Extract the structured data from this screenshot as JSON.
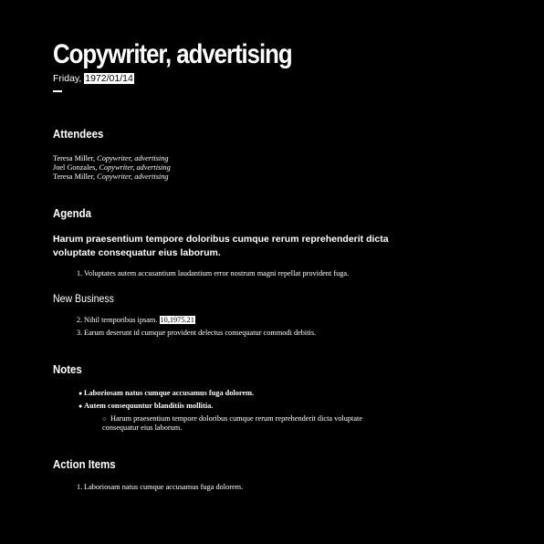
{
  "doc": {
    "title": "Copywriter, advertising",
    "day": "Friday,",
    "date": "1972/01/14"
  },
  "attendees": {
    "heading": "Attendees",
    "people": [
      {
        "name": "Teresa Miller,",
        "role": "Copywriter, advertising"
      },
      {
        "name": "Joel Gonzales,",
        "role": "Copywriter, advertising"
      },
      {
        "name": "Teresa Miller,",
        "role": "Copywriter, advertising"
      }
    ]
  },
  "agenda": {
    "heading": "Agenda",
    "lead": "Harum praesentium tempore doloribus cumque rerum reprehenderit dicta voluptate consequatur eius laborum.",
    "items": [
      {
        "num": "1.",
        "text": "Voluptates autem accusantium laudantium error nostrum magni repellat provident fuga."
      }
    ],
    "subheading": "New Business",
    "items2": [
      {
        "num": "2.",
        "text": "Nihil temporibus ipsam.",
        "tag": "10,1975.21"
      },
      {
        "num": "3.",
        "text": "Earum deserunt id cumque provident delectus consequatur commodi debitis."
      }
    ]
  },
  "notes": {
    "heading": "Notes",
    "items": [
      {
        "text": "Laboriosam natus cumque accusamus fuga dolorem."
      },
      {
        "text": "Autem consequuntur blanditiis mollitia."
      }
    ],
    "subitem": "Harum praesentium tempore doloribus cumque rerum reprehenderit dicta voluptate consequatur eius laborum."
  },
  "actions": {
    "heading": "Action Items",
    "items": [
      {
        "num": "1.",
        "text": "Laboriosam natus cumque accusamus fuga dolorem."
      }
    ]
  }
}
